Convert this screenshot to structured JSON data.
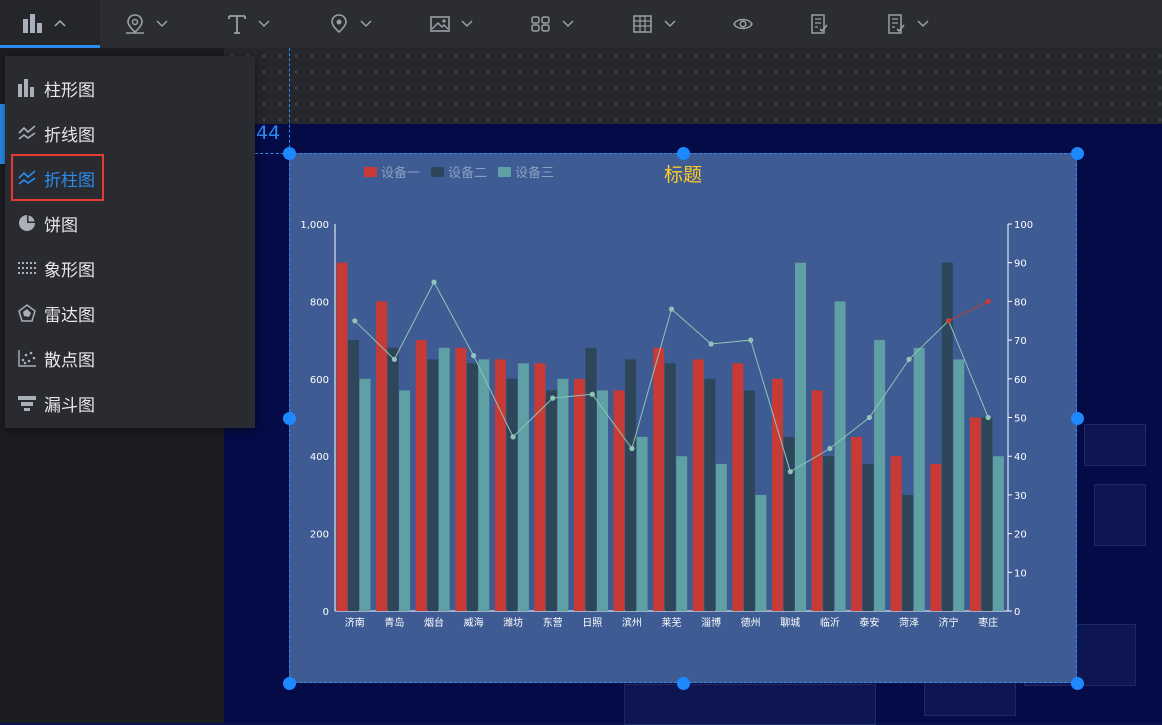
{
  "toolbar": {
    "icons": [
      "bar-chart-icon",
      "map-pin-icon",
      "text-icon",
      "location-icon",
      "image-icon",
      "grid-blocks-icon",
      "table-icon",
      "eye-icon",
      "document-icon",
      "document-check-icon"
    ]
  },
  "dropdown": {
    "items": [
      {
        "label": "柱形图",
        "icon": "bar-chart-icon"
      },
      {
        "label": "折线图",
        "icon": "line-chart-icon"
      },
      {
        "label": "折柱图",
        "icon": "line-bar-chart-icon"
      },
      {
        "label": "饼图",
        "icon": "pie-chart-icon"
      },
      {
        "label": "象形图",
        "icon": "pictorial-chart-icon"
      },
      {
        "label": "雷达图",
        "icon": "radar-chart-icon"
      },
      {
        "label": "散点图",
        "icon": "scatter-chart-icon"
      },
      {
        "label": "漏斗图",
        "icon": "funnel-chart-icon"
      }
    ],
    "selected_index": 2
  },
  "canvas": {
    "position_readout": "44"
  },
  "colors": {
    "accent": "#2a8cf0",
    "series1": "#c83a36",
    "series2": "#2d4659",
    "series3": "#5fa0a4",
    "line": "#8fc4b6",
    "title": "#ffc928"
  },
  "chart_data": {
    "type": "bar",
    "title": "标题",
    "categories": [
      "济南",
      "青岛",
      "烟台",
      "威海",
      "潍坊",
      "东营",
      "日照",
      "滨州",
      "莱芜",
      "淄博",
      "德州",
      "聊城",
      "临沂",
      "泰安",
      "菏泽",
      "济宁",
      "枣庄"
    ],
    "series": [
      {
        "name": "设备一",
        "type": "bar",
        "axis": "left",
        "values": [
          900,
          800,
          700,
          680,
          650,
          640,
          600,
          570,
          680,
          650,
          640,
          600,
          570,
          450,
          400,
          380,
          500
        ]
      },
      {
        "name": "设备二",
        "type": "bar",
        "axis": "left",
        "values": [
          700,
          680,
          650,
          640,
          600,
          570,
          680,
          650,
          640,
          600,
          570,
          450,
          400,
          380,
          300,
          900,
          500
        ]
      },
      {
        "name": "设备三",
        "type": "bar",
        "axis": "left",
        "values": [
          600,
          570,
          680,
          650,
          640,
          600,
          570,
          450,
          400,
          380,
          300,
          900,
          800,
          700,
          680,
          650,
          400
        ]
      },
      {
        "type": "line",
        "axis": "right",
        "values": [
          75,
          65,
          85,
          66,
          45,
          55,
          56,
          42,
          78,
          69,
          70,
          36,
          42,
          50,
          65,
          75,
          50
        ]
      },
      {
        "type": "line",
        "axis": "right",
        "values": [
          null,
          null,
          null,
          null,
          null,
          null,
          null,
          null,
          null,
          null,
          null,
          null,
          null,
          null,
          null,
          75,
          80
        ]
      }
    ],
    "y_left": {
      "min": 0,
      "max": 1000,
      "ticks": [
        "0",
        "200",
        "400",
        "600",
        "800",
        "1,000"
      ]
    },
    "y_right": {
      "min": 0,
      "max": 100,
      "ticks": [
        "0",
        "10",
        "20",
        "30",
        "40",
        "50",
        "60",
        "70",
        "80",
        "90",
        "100"
      ]
    },
    "legend": "top-left",
    "grid": false
  }
}
